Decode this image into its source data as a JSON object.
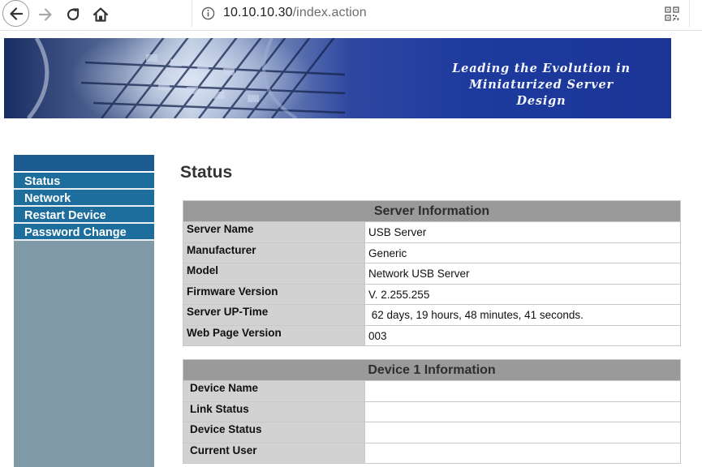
{
  "browser": {
    "url_host": "10.10.10.30",
    "url_path": "/index.action"
  },
  "banner": {
    "tagline_line1": "Leading the Evolution in",
    "tagline_line2": "Miniaturized Server Design"
  },
  "sidebar": {
    "items": [
      {
        "label": "Status"
      },
      {
        "label": "Network"
      },
      {
        "label": "Restart Device"
      },
      {
        "label": "Password Change"
      }
    ]
  },
  "page": {
    "title": "Status"
  },
  "server_info": {
    "header": "Server Information",
    "rows": [
      {
        "label": "Server Name",
        "value": "USB Server"
      },
      {
        "label": "Manufacturer",
        "value": "Generic"
      },
      {
        "label": "Model",
        "value": "Network USB Server"
      },
      {
        "label": "Firmware Version",
        "value": "V. 2.255.255"
      },
      {
        "label": "Server UP-Time",
        "value": " 62 days, 19 hours, 48 minutes, 41 seconds."
      },
      {
        "label": "Web Page Version",
        "value": "003"
      }
    ]
  },
  "device_info": {
    "header": "Device 1 Information",
    "rows": [
      {
        "label": "Device Name",
        "value": ""
      },
      {
        "label": "Link Status",
        "value": ""
      },
      {
        "label": "Device Status",
        "value": ""
      },
      {
        "label": "Current User",
        "value": ""
      }
    ]
  },
  "colors": {
    "sidebar_item_bg": "#1d6e9c",
    "sidebar_bg": "#7f9aa6",
    "table_header_bg": "#9a9a9a",
    "table_label_bg": "#d2d2d2"
  }
}
